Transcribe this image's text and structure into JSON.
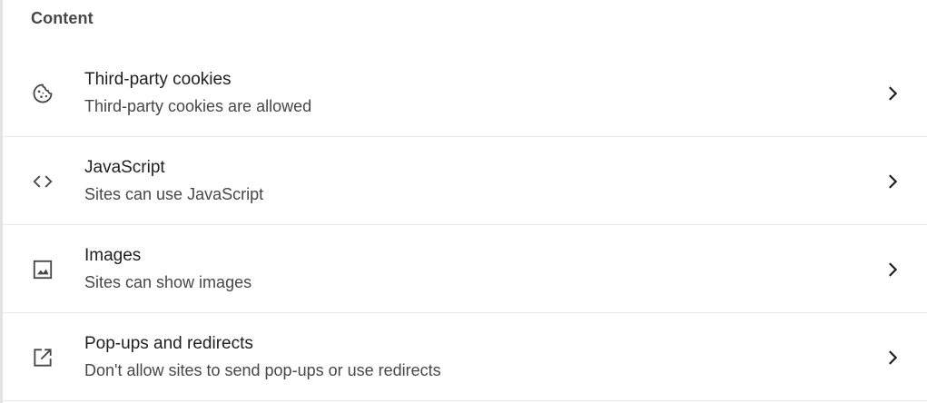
{
  "section": {
    "title": "Content"
  },
  "rows": [
    {
      "icon": "cookie-icon",
      "title": "Third-party cookies",
      "subtitle": "Third-party cookies are allowed"
    },
    {
      "icon": "code-icon",
      "title": "JavaScript",
      "subtitle": "Sites can use JavaScript"
    },
    {
      "icon": "image-icon",
      "title": "Images",
      "subtitle": "Sites can show images"
    },
    {
      "icon": "open-in-new-icon",
      "title": "Pop-ups and redirects",
      "subtitle": "Don't allow sites to send pop-ups or use redirects"
    }
  ],
  "colors": {
    "primary_text": "#1f1f1f",
    "secondary_text": "#474747",
    "divider": "#e8e8e8",
    "icon": "#474747"
  }
}
